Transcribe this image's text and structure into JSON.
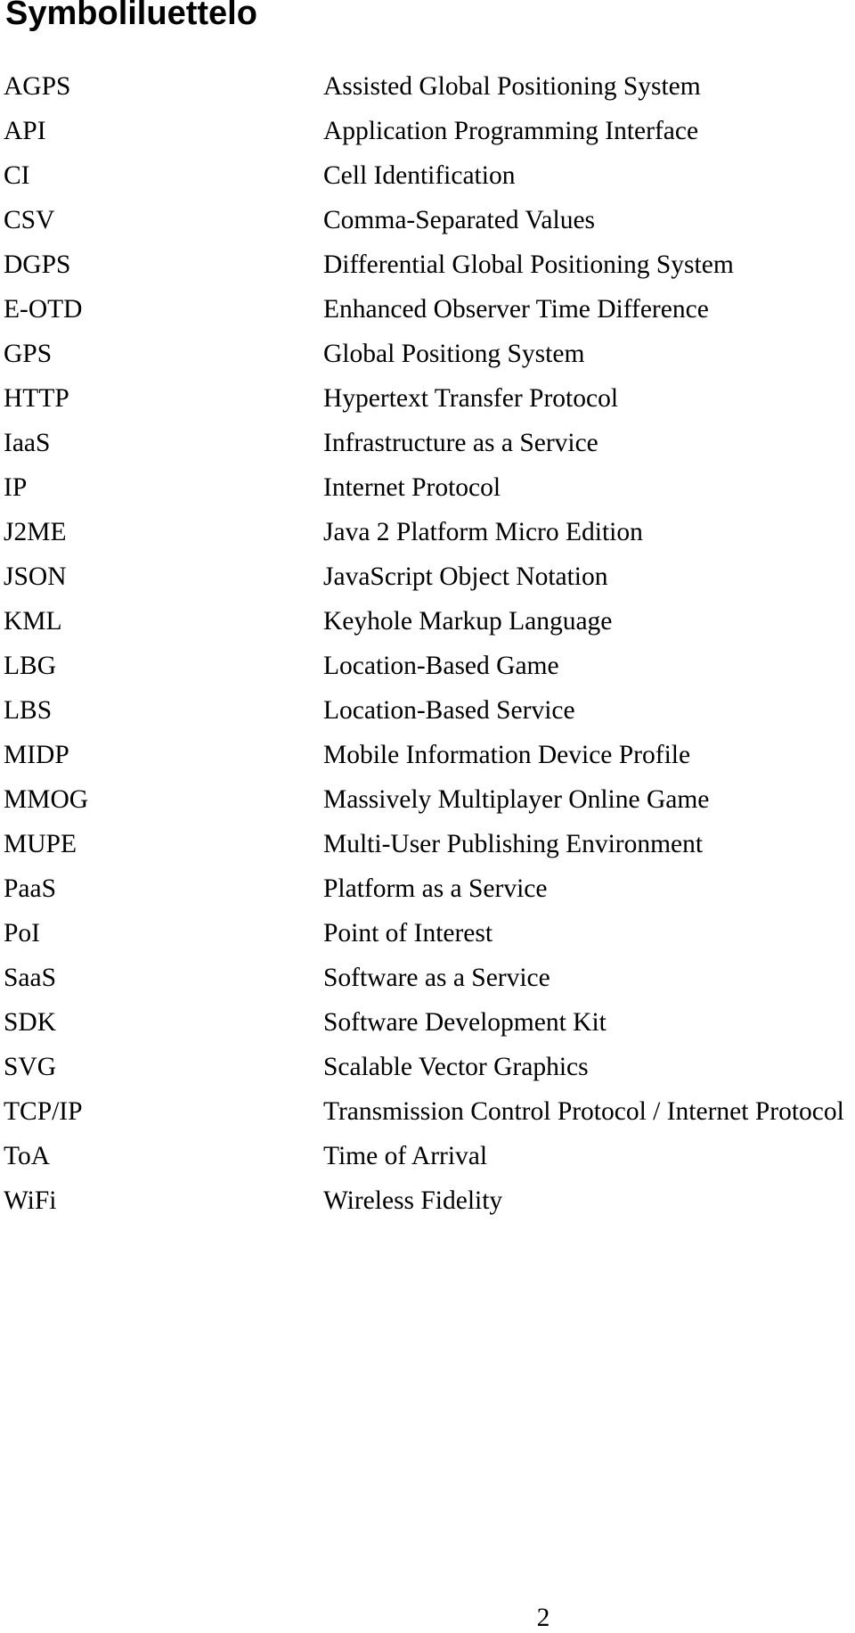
{
  "page": {
    "title": "Symboliluettelo",
    "page_number": "2"
  },
  "symbols": [
    {
      "abbr": "AGPS",
      "expansion": "Assisted Global Positioning System"
    },
    {
      "abbr": "API",
      "expansion": "Application Programming Interface"
    },
    {
      "abbr": "CI",
      "expansion": "Cell Identification"
    },
    {
      "abbr": "CSV",
      "expansion": "Comma-Separated Values"
    },
    {
      "abbr": "DGPS",
      "expansion": "Differential Global Positioning System"
    },
    {
      "abbr": "E-OTD",
      "expansion": "Enhanced Observer Time Difference"
    },
    {
      "abbr": "GPS",
      "expansion": "Global Positiong System"
    },
    {
      "abbr": "HTTP",
      "expansion": "Hypertext Transfer Protocol"
    },
    {
      "abbr": "IaaS",
      "expansion": "Infrastructure as a Service"
    },
    {
      "abbr": "IP",
      "expansion": "Internet Protocol"
    },
    {
      "abbr": "J2ME",
      "expansion": "Java 2 Platform Micro Edition"
    },
    {
      "abbr": "JSON",
      "expansion": "JavaScript Object Notation"
    },
    {
      "abbr": "KML",
      "expansion": "Keyhole Markup Language"
    },
    {
      "abbr": "LBG",
      "expansion": "Location-Based Game"
    },
    {
      "abbr": "LBS",
      "expansion": "Location-Based Service"
    },
    {
      "abbr": "MIDP",
      "expansion": "Mobile Information Device Profile"
    },
    {
      "abbr": "MMOG",
      "expansion": "Massively Multiplayer Online Game"
    },
    {
      "abbr": "MUPE",
      "expansion": "Multi-User Publishing Environment"
    },
    {
      "abbr": "PaaS",
      "expansion": "Platform as a Service"
    },
    {
      "abbr": "PoI",
      "expansion": "Point of Interest"
    },
    {
      "abbr": "SaaS",
      "expansion": "Software as a Service"
    },
    {
      "abbr": "SDK",
      "expansion": "Software Development Kit"
    },
    {
      "abbr": "SVG",
      "expansion": "Scalable Vector Graphics"
    },
    {
      "abbr": "TCP/IP",
      "expansion": "Transmission Control Protocol / Internet Protocol"
    },
    {
      "abbr": "ToA",
      "expansion": "Time of Arrival"
    },
    {
      "abbr": "WiFi",
      "expansion": "Wireless Fidelity"
    }
  ]
}
